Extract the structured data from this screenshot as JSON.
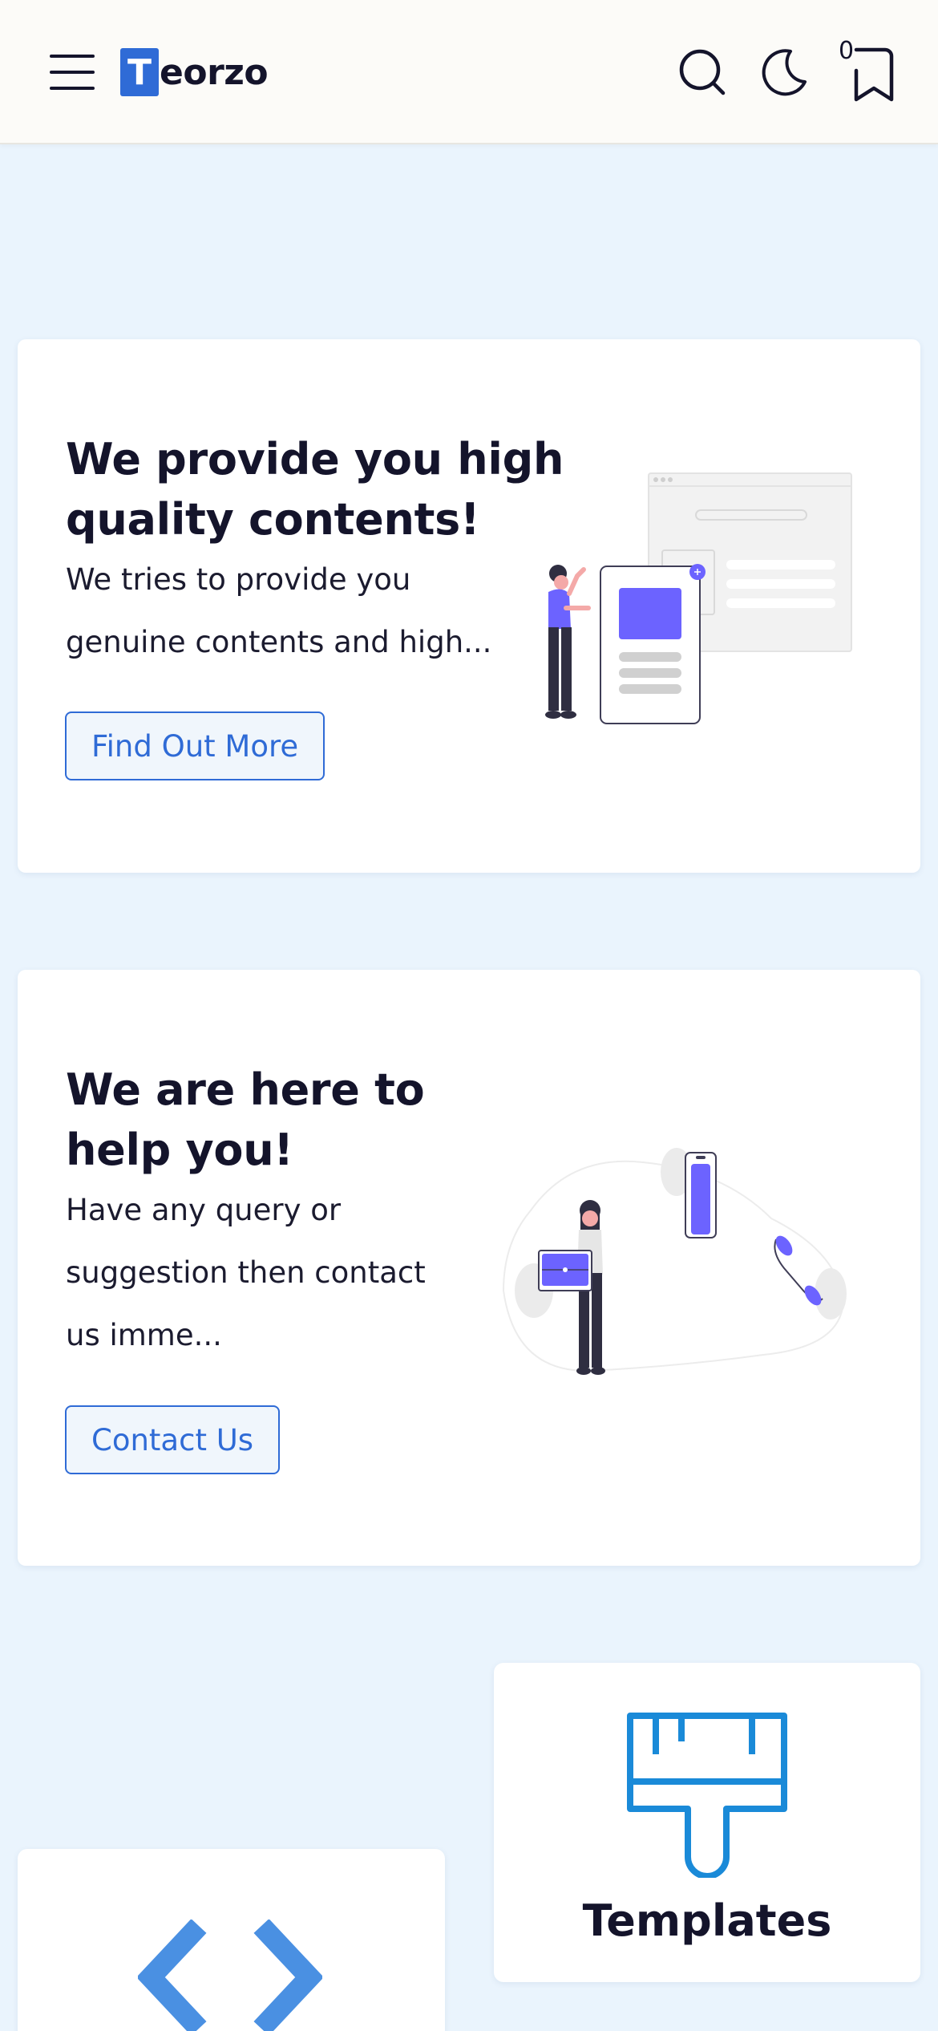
{
  "header": {
    "logo_letter": "T",
    "logo_text": "eorzo",
    "bookmark_count": "0",
    "icons": [
      "menu-icon",
      "search-icon",
      "moon-icon",
      "bookmark-icon"
    ]
  },
  "cards": [
    {
      "title_line1": "We provide you high",
      "title_line2": "quality contents!",
      "text_line1": "We tries to provide you",
      "text_line2": "genuine contents and high...",
      "button_label": "Find Out More"
    },
    {
      "title_line1": "We are here to",
      "title_line2": "help you!",
      "text_line1": "Have any query or",
      "text_line2": "suggestion then contact",
      "text_line3": "us imme...",
      "button_label": "Contact Us"
    }
  ],
  "features": {
    "templates_label": "Templates",
    "templates_icon": "paint-brush-icon",
    "code_icon": "code-brackets-icon"
  },
  "colors": {
    "accent": "#2f6bd6",
    "page_bg": "#eaf4fd",
    "illustration_purple": "#6c63ff",
    "feature_icon_blue": "#1a8ad8"
  }
}
